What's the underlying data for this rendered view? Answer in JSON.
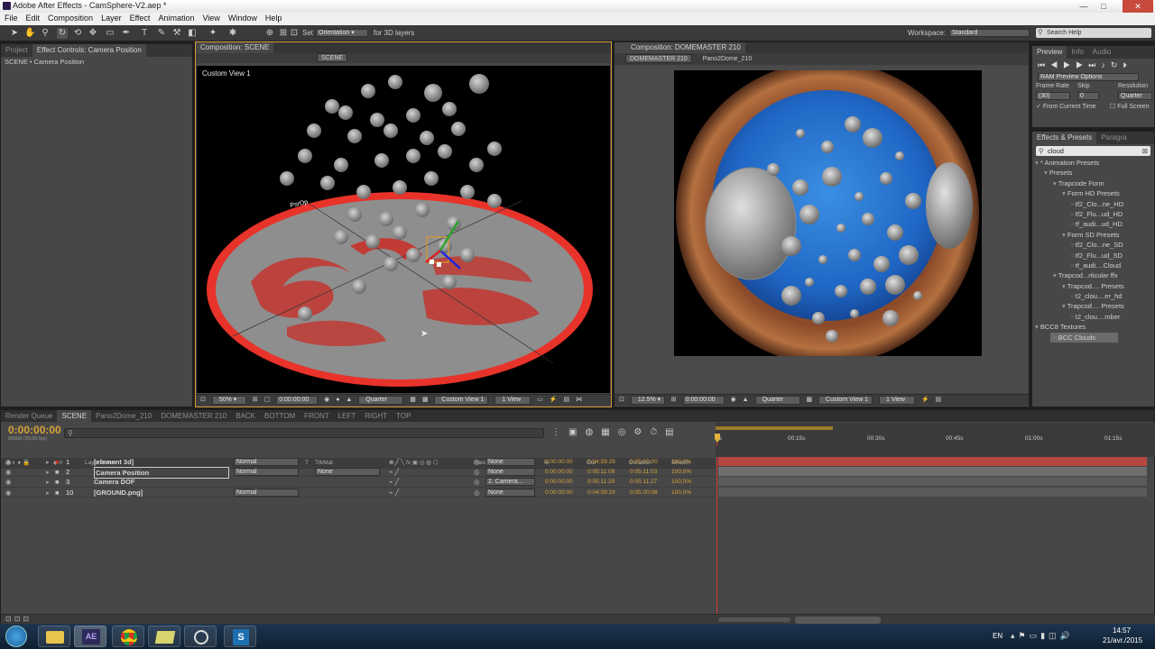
{
  "window": {
    "title": "Adobe After Effects - CamSphere-V2.aep *",
    "minimize": "—",
    "maximize": "□",
    "close": "✕"
  },
  "menu": [
    "File",
    "Edit",
    "Composition",
    "Layer",
    "Effect",
    "Animation",
    "View",
    "Window",
    "Help"
  ],
  "toolbar": {
    "set_label": "Set",
    "orientation": "Orientation",
    "for3d": "for 3D layers",
    "workspace_label": "Workspace:",
    "workspace_value": "Standard",
    "search_placeholder": "Search Help"
  },
  "left_panel": {
    "tabs": [
      "Project",
      "Effect Controls: Camera Position"
    ],
    "breadcrumb": "SCENE • Camera Position"
  },
  "comp_scene": {
    "tab": "Composition: SCENE",
    "sub_tabs": [
      "SCENE"
    ],
    "view_label": "Custom View 1",
    "zoom": "50%",
    "timecode": "0:00:00:00",
    "resolution": "Quarter",
    "camera": "Custom View 1",
    "views": "1 View"
  },
  "comp_dome": {
    "tab": "Composition: DOMEMASTER 210",
    "sub_tabs": [
      "DOMEMASTER 210",
      "Pano2Dome_210"
    ],
    "zoom": "12.5%",
    "timecode": "0:00:00:00",
    "resolution": "Quarter",
    "camera": "Custom View 1",
    "views": "1 View"
  },
  "preview": {
    "tabs": [
      "Preview",
      "Info",
      "Audio"
    ],
    "ram_options": "RAM Preview Options",
    "frame_rate_label": "Frame Rate",
    "skip_label": "Skip",
    "resolution_label": "Resolution",
    "frame_rate": "(30)",
    "skip": "0",
    "resolution": "Quarter",
    "from_current": "From Current Time",
    "full_screen": "Full Screen"
  },
  "effects": {
    "tabs": [
      "Effects & Presets",
      "Paragra"
    ],
    "search": "cloud",
    "tree": [
      {
        "label": "* Animation Presets",
        "depth": 0
      },
      {
        "label": "Presets",
        "depth": 1
      },
      {
        "label": "Trapcode Form",
        "depth": 2
      },
      {
        "label": "Form HD Presets",
        "depth": 3
      },
      {
        "label": "tf2_Clo...ne_HD",
        "depth": 4
      },
      {
        "label": "tf2_Flu...ud_HD",
        "depth": 4
      },
      {
        "label": "tf_audi...ud_HD",
        "depth": 4
      },
      {
        "label": "Form SD Presets",
        "depth": 3
      },
      {
        "label": "tf2_Clo...ne_SD",
        "depth": 4
      },
      {
        "label": "tf2_Flu...ud_SD",
        "depth": 4
      },
      {
        "label": "tf_audi....Cloud",
        "depth": 4
      },
      {
        "label": "Trapcod...rticular ffx",
        "depth": 2
      },
      {
        "label": "Trapcod.... Presets",
        "depth": 3
      },
      {
        "label": "t2_clou....er_hd",
        "depth": 4
      },
      {
        "label": "Trapcod.... Presets",
        "depth": 3
      },
      {
        "label": "t2_clou....mber",
        "depth": 4
      },
      {
        "label": "BCC8 Textures",
        "depth": 0
      },
      {
        "label": "BCC Clouds",
        "depth": 1
      }
    ]
  },
  "timeline": {
    "tabs": [
      "Render Queue",
      "SCENE",
      "Pano2Dome_210",
      "DOMEMASTER 210",
      "BACK",
      "BOTTOM",
      "FRONT",
      "LEFT",
      "RIGHT",
      "TOP"
    ],
    "timecode": "0:00:00:00",
    "fps": "00000 (30.00 fps)",
    "columns": {
      "name": "Layer Name",
      "mode": "Mode",
      "t": "T",
      "trkmat": "TrkMat",
      "parent": "Parent",
      "in": "In",
      "out": "Out",
      "duration": "Duration",
      "stretch": "Stretch"
    },
    "ruler": [
      "00:15s",
      "00:30s",
      "00:45s",
      "01:00s",
      "01:15s"
    ],
    "layers": [
      {
        "num": "1",
        "name": "[element 3d]",
        "mode": "Normal",
        "trkmat": "",
        "parent": "None",
        "in": "0:00:00:00",
        "out": "0:04:59:29",
        "duration": "0:05:00:00",
        "stretch": "100,0%"
      },
      {
        "num": "2",
        "name": "Camera Position",
        "mode": "Normal",
        "trkmat": "None",
        "parent": "None",
        "in": "0:00:00:00",
        "out": "0:05:11:09",
        "duration": "0:05:11:03",
        "stretch": "100,0%"
      },
      {
        "num": "3",
        "name": "Camera DOF",
        "mode": "",
        "trkmat": "",
        "parent": "2. Camera...",
        "in": "0:00:00:00",
        "out": "0:05:11:29",
        "duration": "0:05:11:27",
        "stretch": "100,0%"
      },
      {
        "num": "10",
        "name": "[GROUND.png]",
        "mode": "Normal",
        "trkmat": "",
        "parent": "None",
        "in": "0:00:00:00",
        "out": "0:04:59:29",
        "duration": "0:05:00:08",
        "stretch": "100,0%"
      }
    ]
  },
  "taskbar": {
    "lang": "EN",
    "time": "14:57",
    "date": "21/avr./2015"
  },
  "colors": {
    "accent": "#d7a33a",
    "ground_ring": "#e8332a",
    "sky": "#2e86dc"
  }
}
